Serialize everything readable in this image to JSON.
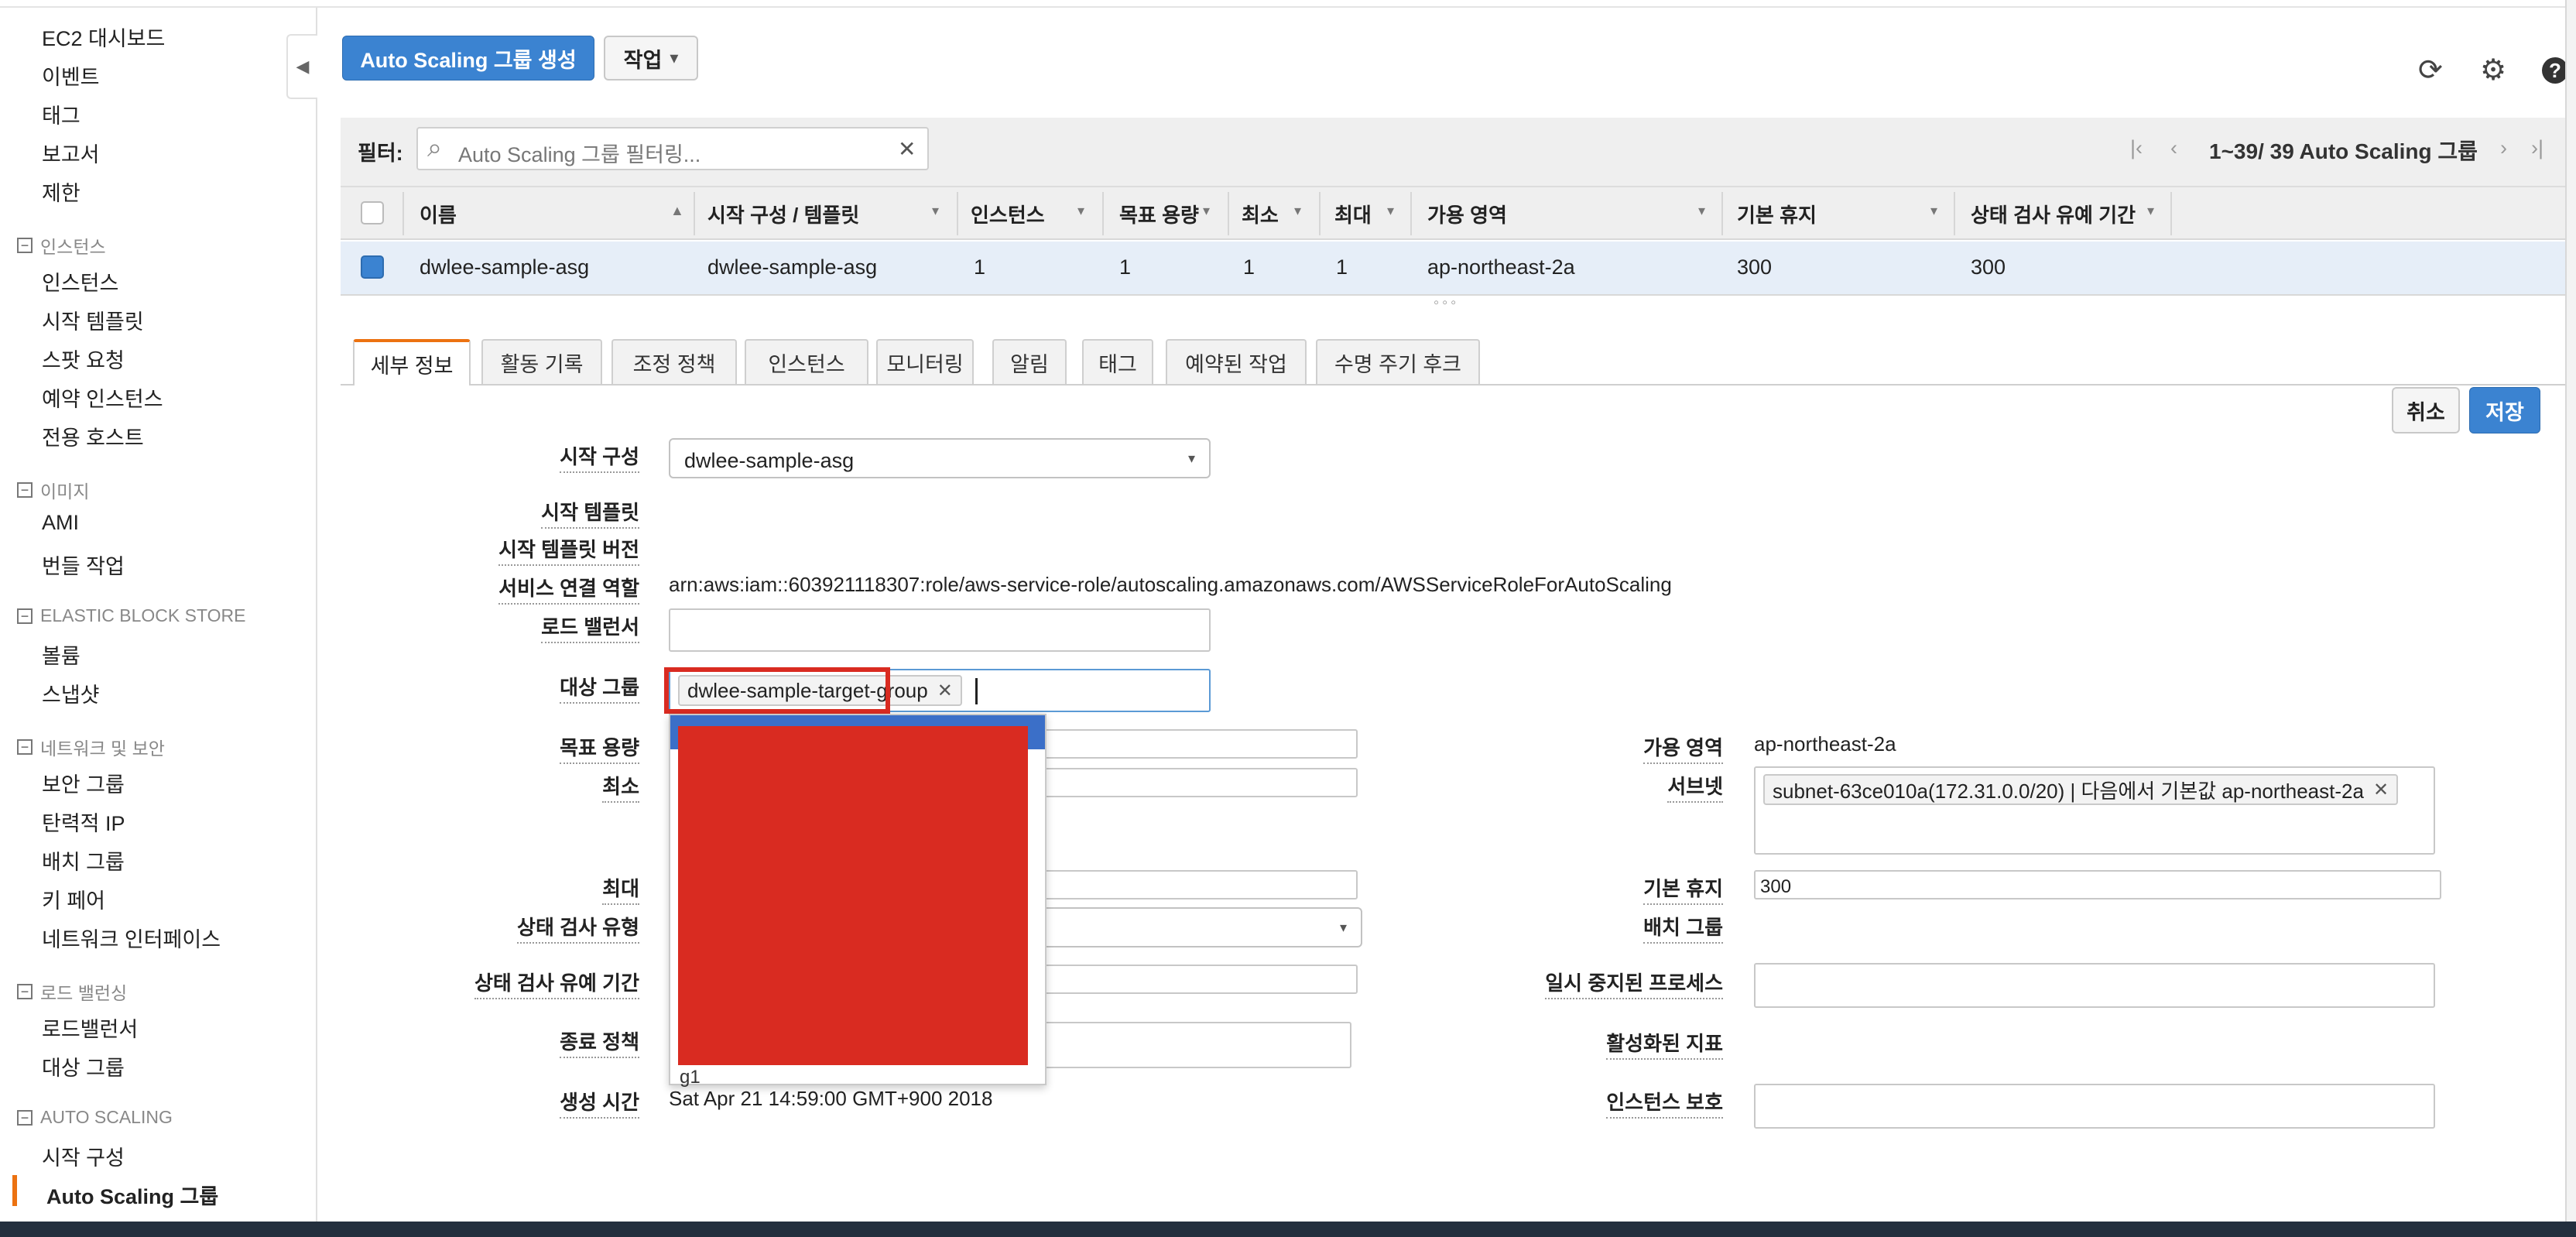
{
  "sidebar": {
    "items_top": [
      "EC2 대시보드",
      "이벤트",
      "태그",
      "보고서",
      "제한"
    ],
    "sections": [
      {
        "title": "인스턴스",
        "items": [
          "인스턴스",
          "시작 템플릿",
          "스팟 요청",
          "예약 인스턴스",
          "전용 호스트"
        ]
      },
      {
        "title": "이미지",
        "items": [
          "AMI",
          "번들 작업"
        ]
      },
      {
        "title": "ELASTIC BLOCK STORE",
        "items": [
          "볼륨",
          "스냅샷"
        ]
      },
      {
        "title": "네트워크 및 보안",
        "items": [
          "보안 그룹",
          "탄력적 IP",
          "배치 그룹",
          "키 페어",
          "네트워크 인터페이스"
        ]
      },
      {
        "title": "로드 밸런싱",
        "items": [
          "로드밸런서",
          "대상 그룹"
        ]
      },
      {
        "title": "AUTO SCALING",
        "items": [
          "시작 구성",
          "Auto Scaling 그룹"
        ]
      }
    ],
    "collapse_glyph": "◀",
    "section_toggle": "−"
  },
  "toolbar": {
    "create_label": "Auto Scaling 그룹 생성",
    "actions_label": "작업",
    "actions_caret": "▾",
    "icons": [
      "refresh-icon",
      "gear-icon",
      "help-icon"
    ],
    "refresh_glyph": "⟳",
    "gear_glyph": "⚙",
    "help_glyph": "?"
  },
  "filter": {
    "label": "필터:",
    "placeholder": "Auto Scaling 그룹 필터링...",
    "search_glyph": "⌕",
    "clear_glyph": "✕",
    "pager_text": "1~39/ 39 Auto Scaling 그룹",
    "first_glyph": "|‹",
    "prev_glyph": "‹",
    "next_glyph": "›",
    "last_glyph": "›|"
  },
  "table": {
    "headers": [
      "이름",
      "시작 구성 / 템플릿",
      "인스턴스",
      "목표 용량",
      "최소",
      "최대",
      "가용 영역",
      "기본 휴지",
      "상태 검사 유예 기간"
    ],
    "sort_glyph": "▲",
    "menu_glyph": "▾",
    "row": [
      "dwlee-sample-asg",
      "dwlee-sample-asg",
      "1",
      "1",
      "1",
      "1",
      "ap-northeast-2a",
      "300",
      "300"
    ],
    "resize_glyph": "◦◦◦"
  },
  "tabs": [
    "세부 정보",
    "활동 기록",
    "조정 정책",
    "인스턴스",
    "모니터링",
    "알림",
    "태그",
    "예약된 작업",
    "수명 주기 후크"
  ],
  "actions": {
    "cancel": "취소",
    "save": "저장"
  },
  "details": {
    "launch_config_label": "시작 구성",
    "launch_config_value": "dwlee-sample-asg",
    "launch_template_label": "시작 템플릿",
    "launch_template_version_label": "시작 템플릿 버전",
    "service_role_label": "서비스 연결 역할",
    "service_role_value": "arn:aws:iam::603921118307:role/aws-service-role/autoscaling.amazonaws.com/AWSServiceRoleForAutoScaling",
    "load_balancer_label": "로드 밸런서",
    "target_group_label": "대상 그룹",
    "target_group_token": "dwlee-sample-target-group",
    "token_remove_glyph": "✕",
    "desired_label": "목표 용량",
    "min_label": "최소",
    "max_label": "최대",
    "health_check_type_label": "상태 검사 유형",
    "health_grace_label": "상태 검사 유예 기간",
    "termination_label": "종료 정책",
    "created_label": "생성 시간",
    "created_value": "Sat Apr 21 14:59:00 GMT+900 2018",
    "az_label": "가용 영역",
    "az_value": "ap-northeast-2a",
    "subnet_label": "서브넷",
    "subnet_token": "subnet-63ce010a(172.31.0.0/20) | 다음에서 기본값 ap-northeast-2a",
    "default_cooldown_label": "기본 휴지",
    "default_cooldown_value": "300",
    "placement_group_label": "배치 그룹",
    "suspended_label": "일시 중지된 프로세스",
    "metrics_label": "활성화된 지표",
    "protection_label": "인스턴스 보호",
    "dropdown_partial": "g1",
    "select_caret": "▾"
  },
  "colors": {
    "primary": "#3b83d1",
    "highlight_border": "#d92b21",
    "redaction": "#d92b21",
    "active_tab": "#ec7211"
  }
}
